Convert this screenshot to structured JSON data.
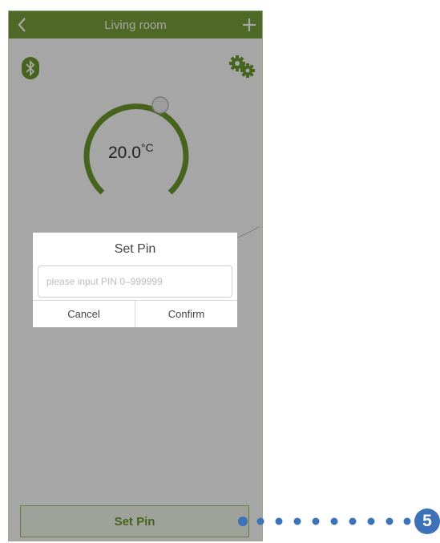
{
  "header": {
    "title": "Living room",
    "back_icon": "chevron-left-icon",
    "add_icon": "plus-icon"
  },
  "toolbar": {
    "bluetooth_icon": "bluetooth-icon",
    "settings_icon": "gears-icon"
  },
  "thermostat": {
    "temperature": "20.0",
    "unit": "°C"
  },
  "footer": {
    "set_pin_label": "Set Pin"
  },
  "dialog": {
    "title": "Set Pin",
    "placeholder": "please input PIN 0–999999",
    "value": "",
    "cancel_label": "Cancel",
    "confirm_label": "Confirm"
  },
  "annotation": {
    "number": "5"
  },
  "colors": {
    "accent": "#79a03a",
    "callout": "#3e72b8"
  }
}
